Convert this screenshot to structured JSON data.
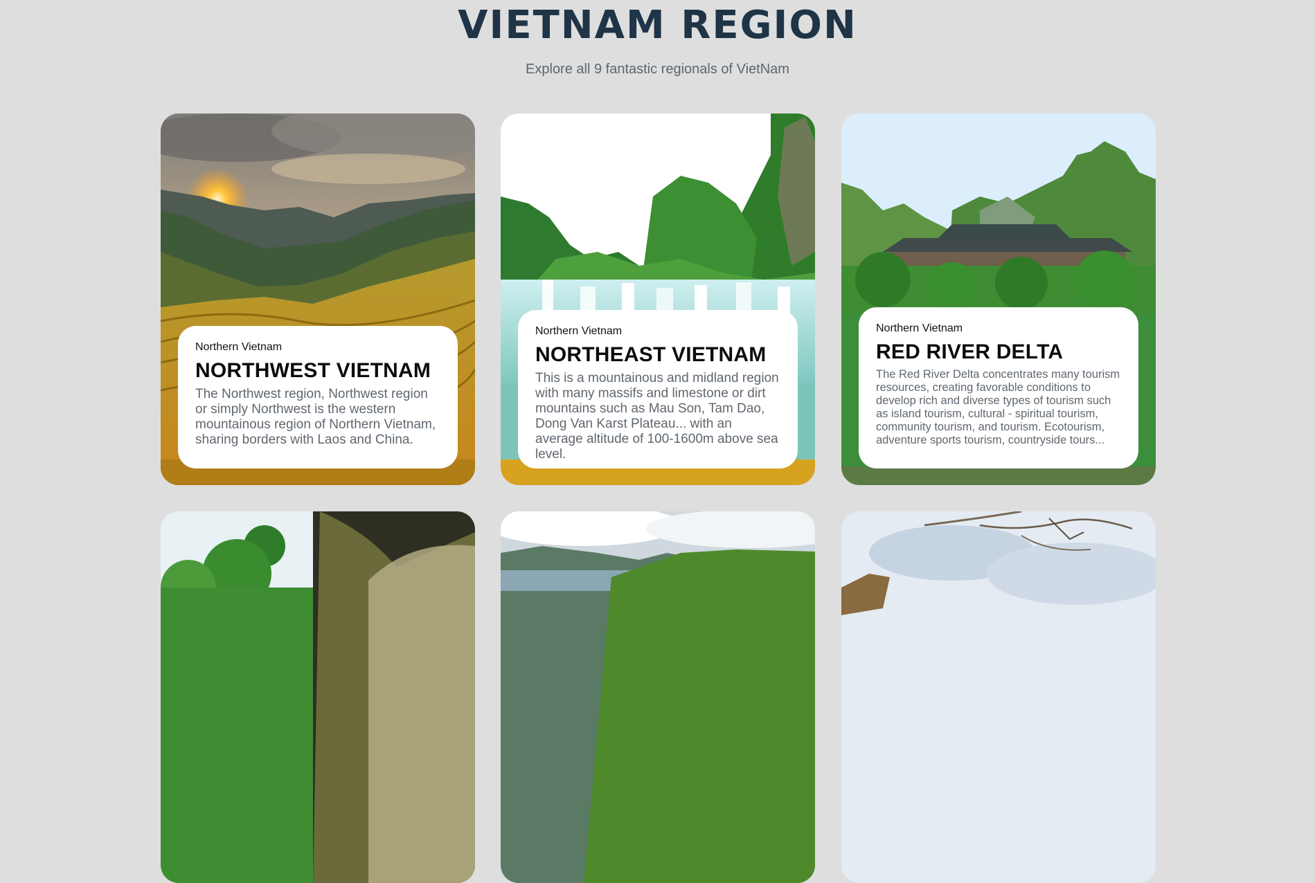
{
  "header": {
    "title": "VIETNAM REGION",
    "subtitle": "Explore all 9 fantastic regionals of VietNam"
  },
  "cards": [
    {
      "region": "Northern Vietnam",
      "title": "NORTHWEST VIETNAM",
      "description": "The Northwest region, Northwest region or simply Northwest is the western mountainous region of Northern Vietnam, sharing borders with Laos and China.",
      "image": "sunset-over-rice-terraces"
    },
    {
      "region": "Northern Vietnam",
      "title": "NORTHEAST VIETNAM",
      "description": "This is a mountainous and midland region with many massifs and limestone or dirt mountains such as Mau Son, Tam Dao, Dong Van Karst Plateau... with an average altitude of 100-1600m above sea level.",
      "image": "waterfall-and-limestone-mountains"
    },
    {
      "region": "Northern Vietnam",
      "title": "RED RIVER DELTA",
      "description": "The Red River Delta concentrates many tourism resources, creating favorable conditions to develop rich and diverse types of tourism such as island tourism, cultural - spiritual tourism, community tourism, and tourism. Ecotourism, adventure sports tourism, countryside tours...",
      "image": "pagoda-among-karst-mountains"
    },
    {
      "image": "jungle-and-cave"
    },
    {
      "image": "bay-with-islands"
    },
    {
      "image": "bare-branches-and-sky"
    }
  ]
}
